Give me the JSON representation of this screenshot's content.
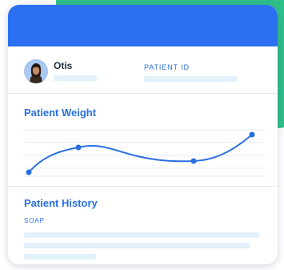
{
  "patient": {
    "name": "Otis",
    "id_label": "PATIENT ID"
  },
  "weight": {
    "title": "Patient Weight"
  },
  "history": {
    "title": "Patient History",
    "note_label": "SOAP"
  },
  "colors": {
    "header": "#2b70f0",
    "accent_background": "#2fc08a",
    "chart_line": "#2b6fe0",
    "placeholder": "#e3f1fb"
  }
}
